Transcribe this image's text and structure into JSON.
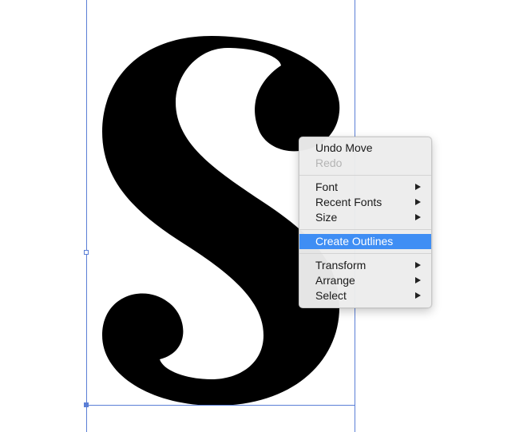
{
  "canvas": {
    "glyph_char": "S",
    "glyph_color": "#000000",
    "selection_color": "#5b7fd6"
  },
  "context_menu": {
    "groups": [
      [
        {
          "label": "Undo Move",
          "enabled": true,
          "submenu": false
        },
        {
          "label": "Redo",
          "enabled": false,
          "submenu": false
        }
      ],
      [
        {
          "label": "Font",
          "enabled": true,
          "submenu": true
        },
        {
          "label": "Recent Fonts",
          "enabled": true,
          "submenu": true
        },
        {
          "label": "Size",
          "enabled": true,
          "submenu": true
        }
      ],
      [
        {
          "label": "Create Outlines",
          "enabled": true,
          "submenu": false,
          "highlighted": true
        }
      ],
      [
        {
          "label": "Transform",
          "enabled": true,
          "submenu": true
        },
        {
          "label": "Arrange",
          "enabled": true,
          "submenu": true
        },
        {
          "label": "Select",
          "enabled": true,
          "submenu": true
        }
      ]
    ],
    "highlight_color": "#3f8ef4"
  }
}
